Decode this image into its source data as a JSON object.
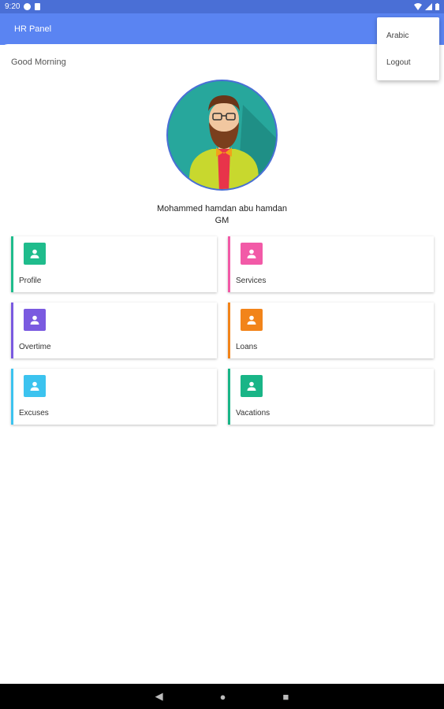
{
  "status_bar": {
    "time": "9:20"
  },
  "app_bar": {
    "title": "HR Panel"
  },
  "greeting": "Good Morning",
  "user": {
    "name": "Mohammed hamdan abu hamdan",
    "role": "GM"
  },
  "menu": {
    "items": [
      {
        "label": "Arabic"
      },
      {
        "label": "Logout"
      }
    ]
  },
  "cards": [
    {
      "label": "Profile",
      "color": "#1fbc8c"
    },
    {
      "label": "Services",
      "color": "#f25aa7"
    },
    {
      "label": "Overtime",
      "color": "#7a5ae0"
    },
    {
      "label": "Loans",
      "color": "#f2841a"
    },
    {
      "label": "Excuses",
      "color": "#3cc3ef"
    },
    {
      "label": "Vacations",
      "color": "#19b587"
    }
  ],
  "nav": {
    "back_icon": "back-triangle-icon",
    "home_icon": "home-circle-icon",
    "recents_icon": "recents-square-icon"
  }
}
